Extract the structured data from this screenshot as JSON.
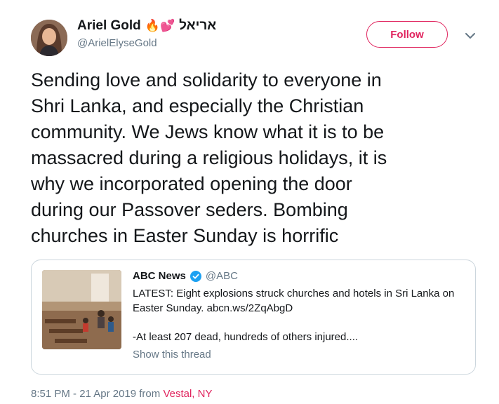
{
  "author": {
    "name": "Ariel Gold",
    "emoji": "🔥💕",
    "hebrew_name": "אריאל",
    "handle": "@ArielElyseGold"
  },
  "follow_label": "Follow",
  "tweet": {
    "lines": [
      "Sending love and solidarity to everyone in",
      "Shri Lanka, and especially the Christian",
      "community. We Jews know what it is to be",
      "massacred during a religious holidays, it is",
      "why we incorporated opening the door",
      "during our Passover seders. Bombing",
      "churches in Easter Sunday is horrific"
    ]
  },
  "quote": {
    "name": "ABC News",
    "handle": "@ABC",
    "line1": "LATEST: Eight explosions struck churches and hotels in Sri Lanka on",
    "line2": "Easter Sunday. abcn.ws/2ZqAbgD",
    "line3": "-At least 207 dead, hundreds of others injured....",
    "show_thread": "Show this thread"
  },
  "meta": {
    "time": "8:51 PM - 21 Apr 2019 from ",
    "location": "Vestal, NY"
  },
  "colors": {
    "accent": "#e0245e",
    "muted": "#657786",
    "text": "#14171a",
    "verified": "#1da1f2",
    "border": "#ccd6dd"
  }
}
